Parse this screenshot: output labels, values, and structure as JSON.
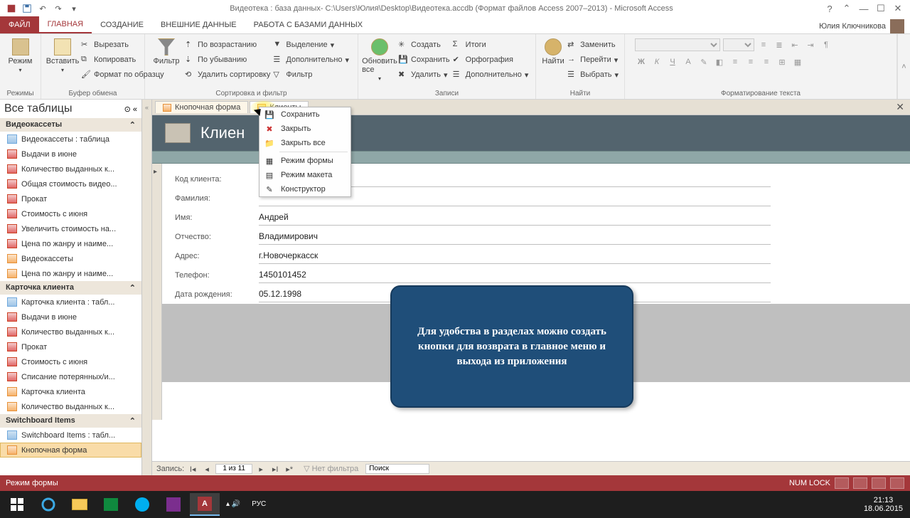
{
  "window": {
    "title": "Видеотека : база данных- C:\\Users\\Юлия\\Desktop\\Видеотека.accdb (Формат файлов Access 2007–2013) - Microsoft Access"
  },
  "account": {
    "name": "Юлия Ключникова"
  },
  "ribbon": {
    "file": "ФАЙЛ",
    "tabs": [
      "ГЛАВНАЯ",
      "СОЗДАНИЕ",
      "ВНЕШНИЕ ДАННЫЕ",
      "РАБОТА С БАЗАМИ ДАННЫХ"
    ],
    "groups": {
      "modes": "Режимы",
      "mode_btn": "Режим",
      "clipboard": "Буфер обмена",
      "paste": "Вставить",
      "cut": "Вырезать",
      "copy": "Копировать",
      "fmtpaint": "Формат по образцу",
      "sortfilter": "Сортировка и фильтр",
      "filter": "Фильтр",
      "asc": "По возрастанию",
      "desc": "По убыванию",
      "clrsort": "Удалить сортировку",
      "selection": "Выделение",
      "advanced": "Дополнительно",
      "togglefilter": "Фильтр",
      "records": "Записи",
      "refresh": "Обновить все",
      "new": "Создать",
      "save": "Сохранить",
      "delete": "Удалить",
      "totals": "Итоги",
      "spelling": "Орфография",
      "more": "Дополнительно",
      "find": "Найти",
      "find_btn": "Найти",
      "replace": "Заменить",
      "goto": "Перейти",
      "select": "Выбрать",
      "textfmt": "Форматирование текста"
    }
  },
  "nav": {
    "title": "Все таблицы",
    "g1": "Видеокассеты",
    "g1items": [
      "Видеокассеты : таблица",
      "Выдачи в июне",
      "Количество выданных к...",
      "Общая стоимость видео...",
      "Прокат",
      "Стоимость с июня",
      "Увеличить стоимость на...",
      "Цена по жанру и наиме...",
      "Видеокассеты",
      "Цена по жанру и наиме..."
    ],
    "g2": "Карточка клиента",
    "g2items": [
      "Карточка клиента : табл...",
      "Выдачи в июне",
      "Количество выданных к...",
      "Прокат",
      "Стоимость с июня",
      "Списание потерянных/и...",
      "Карточка клиента",
      "Количество выданных к..."
    ],
    "g3": "Switchboard Items",
    "g3items": [
      "Switchboard Items : табл...",
      "Кнопочная форма"
    ]
  },
  "tabs": {
    "t1": "Кнопочная форма",
    "t2": "Клиенты"
  },
  "ctx": {
    "save": "Сохранить",
    "close": "Закрыть",
    "closeall": "Закрыть все",
    "formview": "Режим формы",
    "layout": "Режим макета",
    "design": "Конструктор"
  },
  "form": {
    "title": "Клиен",
    "labels": {
      "code": "Код клиента:",
      "last": "Фамилия:",
      "first": "Имя:",
      "mid": "Отчество:",
      "addr": "Адрес:",
      "phone": "Телефон:",
      "dob": "Дата рождения:"
    },
    "values": {
      "code": "",
      "last": "",
      "first": "Андрей",
      "mid": "Владимирович",
      "addr": "г.Новочеркасск",
      "phone": "1450101452",
      "dob": "05.12.1998"
    }
  },
  "recnav": {
    "label": "Запись:",
    "pos": "1 из 11",
    "nofilter": "Нет фильтра",
    "search": "Поиск"
  },
  "status": {
    "mode": "Режим формы",
    "numlock": "NUM LOCK"
  },
  "callout": "Для удобства в разделах можно создать кнопки для возврата в главное меню и выхода из приложения",
  "taskbar": {
    "lang": "РУС",
    "time": "21:13",
    "date": "18.06.2015"
  }
}
